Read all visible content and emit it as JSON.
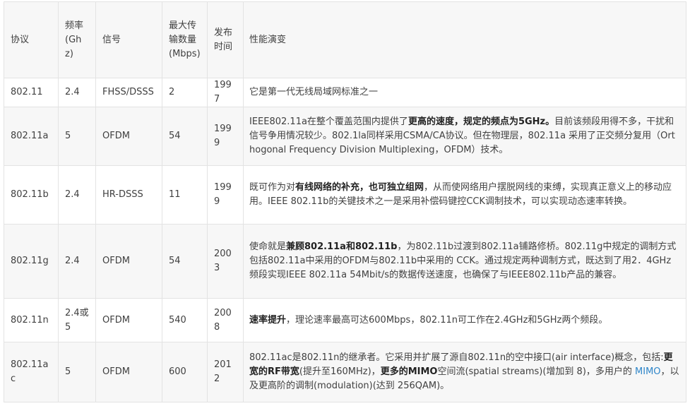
{
  "header": {
    "protocol": "协议",
    "freq": "频率(Ghz)",
    "signal": "信号",
    "max_rate": "最大传输数量(Mbps)",
    "release": "发布时间",
    "evolution": "性能演变"
  },
  "rows": [
    {
      "protocol": "802.11",
      "freq": "2.4",
      "signal": "FHSS/DSSS",
      "rate": "2",
      "year": "1997",
      "desc": [
        {
          "t": "它是第一代无线局域网标准之一"
        }
      ]
    },
    {
      "protocol": "802.11a",
      "freq": "5",
      "signal": "OFDM",
      "rate": "54",
      "year": "1999",
      "desc": [
        {
          "t": "IEEE802.11a在整个覆盖范围内提供了"
        },
        {
          "t": "更高的速度，规定的频点为5GHz。",
          "b": true
        },
        {
          "t": "目前该频段用得不多，干扰和信号争用情况较少。802.1la同样采用CSMA/CA协议。但在物理层，802.11a 采用了正交频分复用（Orthogonal Frequency Division Multiplexing，OFDM）技术。"
        }
      ]
    },
    {
      "protocol": "802.11b",
      "freq": "2.4",
      "signal": "HR-DSSS",
      "rate": "11",
      "year": "1999",
      "desc": [
        {
          "t": "既可作为对"
        },
        {
          "t": "有线网络的补充，也可独立组网",
          "b": true
        },
        {
          "t": "，从而使网络用户摆脱网线的束缚，实现真正意义上的移动应用。IEEE 802.11b的关键技术之一是采用补偿码键控CCK调制技术，可以实现动态速率转换。"
        }
      ]
    },
    {
      "protocol": "802.11g",
      "freq": "2.4",
      "signal": "OFDM",
      "rate": "54",
      "year": "2003",
      "desc": [
        {
          "t": "使命就是"
        },
        {
          "t": "兼顾802.11a和802.11b",
          "b": true
        },
        {
          "t": "，为802.11b过渡到802.11a铺路修桥。802.11g中规定的调制方式包括802.11a中采用的OFDM与802.11b中采用的 CCK。通过规定两种调制方式，既达到了用2．4GHz频段实现IEEE 802.11a 54Mbit/s的数据传送速度，也确保了与IEEE802.11b产品的兼容。"
        }
      ]
    },
    {
      "protocol": "802.11n",
      "freq": "2.4或5",
      "signal": "OFDM",
      "rate": "540",
      "year": "2008",
      "desc": [
        {
          "t": "速率提升",
          "b": true
        },
        {
          "t": "，理论速率最高可达600Mbps，802.11n可工作在2.4GHz和5GHz两个频段。"
        }
      ]
    },
    {
      "protocol": "802.11ac",
      "freq": "5",
      "signal": "OFDM",
      "rate": "600",
      "year": "2012",
      "desc": [
        {
          "t": "802.11ac是802.11n的继承者。它采用并扩展了源自802.11n的空中接口(air interface)概念，包括:"
        },
        {
          "t": "更宽的RF带宽",
          "b": true
        },
        {
          "t": "(提升至160MHz)，"
        },
        {
          "t": "更多的MIMO",
          "b": true
        },
        {
          "t": "空间流(spatial streams)(增加到 8)，多用户的 "
        },
        {
          "t": "MIMO",
          "link": true
        },
        {
          "t": "，以及更高阶的调制(modulation)(达到 256QAM)。"
        }
      ]
    }
  ]
}
